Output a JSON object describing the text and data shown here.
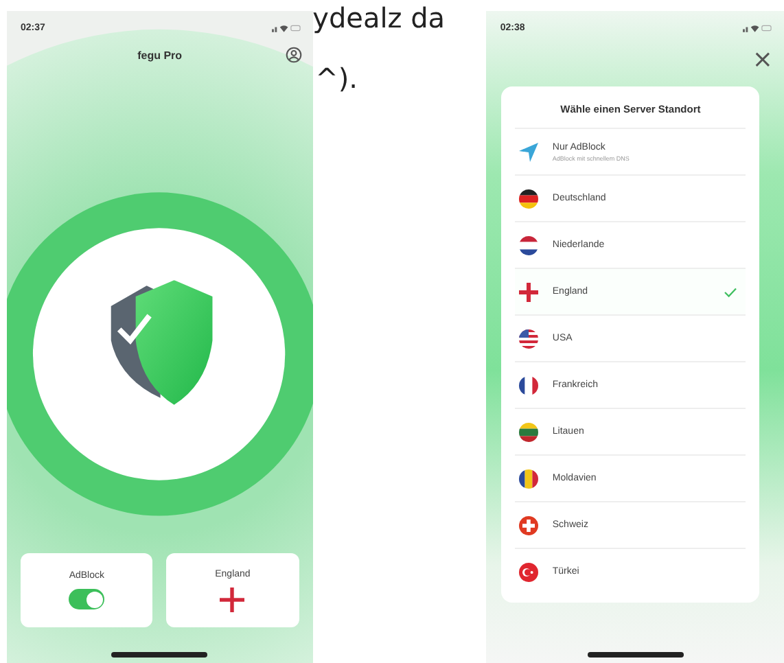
{
  "background_text": [
    "ydealz da",
    "^)."
  ],
  "home_screen": {
    "status_bar": {
      "time": "02:37"
    },
    "title": "fegu Pro",
    "cards": [
      {
        "kind": "toggle",
        "label": "AdBlock",
        "on": true
      },
      {
        "kind": "england",
        "label": "England"
      }
    ]
  },
  "server_screen": {
    "status_bar": {
      "time": "02:38"
    },
    "close": "×",
    "dialog": {
      "title": "Wähle einen Server Standort",
      "items": [
        {
          "kind": "location",
          "label": "Nur AdBlock",
          "sublabel": "AdBlock mit schnellem DNS",
          "selected": false
        },
        {
          "kind": "germany",
          "label": "Deutschland",
          "selected": false
        },
        {
          "kind": "netherlands",
          "label": "Niederlande",
          "selected": false
        },
        {
          "kind": "england",
          "label": "England",
          "selected": true
        },
        {
          "kind": "usa",
          "label": "USA",
          "selected": false
        },
        {
          "kind": "france",
          "label": "Frankreich",
          "selected": false
        },
        {
          "kind": "lithuania",
          "label": "Litauen",
          "selected": false
        },
        {
          "kind": "moldova",
          "label": "Moldavien",
          "selected": false
        },
        {
          "kind": "switzerland",
          "label": "Schweiz",
          "selected": false
        },
        {
          "kind": "turkey",
          "label": "Türkei",
          "selected": false
        }
      ]
    }
  }
}
